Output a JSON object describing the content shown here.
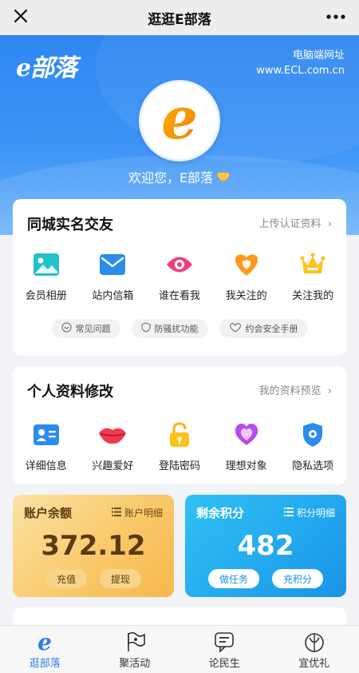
{
  "topbar": {
    "title": "逛逛E部落",
    "close_icon": "close-icon",
    "more_icon": "more-icon"
  },
  "hero": {
    "brand": "e部落",
    "pc_label": "电脑端网址",
    "pc_url": "www.ECL.com.cn",
    "avatar_letter": "e",
    "welcome": "欢迎您，E部落"
  },
  "social": {
    "title": "同城实名交友",
    "link": "上传认证资料",
    "items": [
      {
        "label": "会员相册",
        "icon": "photo-album-icon"
      },
      {
        "label": "站内信箱",
        "icon": "mail-icon"
      },
      {
        "label": "谁在看我",
        "icon": "eye-icon"
      },
      {
        "label": "我关注的",
        "icon": "heart-icon"
      },
      {
        "label": "关注我的",
        "icon": "crown-icon"
      }
    ],
    "pills": [
      {
        "label": "常见问题",
        "icon": "question-icon"
      },
      {
        "label": "防骚扰功能",
        "icon": "shield-icon"
      },
      {
        "label": "约会安全手册",
        "icon": "hearts-icon"
      }
    ]
  },
  "profile": {
    "title": "个人资料修改",
    "link": "我的资料预览",
    "items": [
      {
        "label": "详细信息",
        "icon": "id-card-icon"
      },
      {
        "label": "兴趣爱好",
        "icon": "lips-icon"
      },
      {
        "label": "登陆密码",
        "icon": "lock-icon"
      },
      {
        "label": "理想对象",
        "icon": "ideal-heart-icon"
      },
      {
        "label": "隐私选项",
        "icon": "privacy-shield-icon"
      }
    ]
  },
  "account": {
    "title": "账户余额",
    "detail": "账户明细",
    "value": "372.12",
    "btn1": "充值",
    "btn2": "提现"
  },
  "points": {
    "title": "剩余积分",
    "detail": "积分明细",
    "value": "482",
    "btn1": "做任务",
    "btn2": "充积分"
  },
  "tabs": [
    {
      "label": "逛部落",
      "icon": "e-logo-icon"
    },
    {
      "label": "聚活动",
      "icon": "flag-icon"
    },
    {
      "label": "论民生",
      "icon": "chat-icon"
    },
    {
      "label": "宜优礼",
      "icon": "gift-icon"
    }
  ],
  "colors": {
    "accent": "#2f7de8",
    "orange": "#ff8a00",
    "gold": "#f6c35a"
  }
}
